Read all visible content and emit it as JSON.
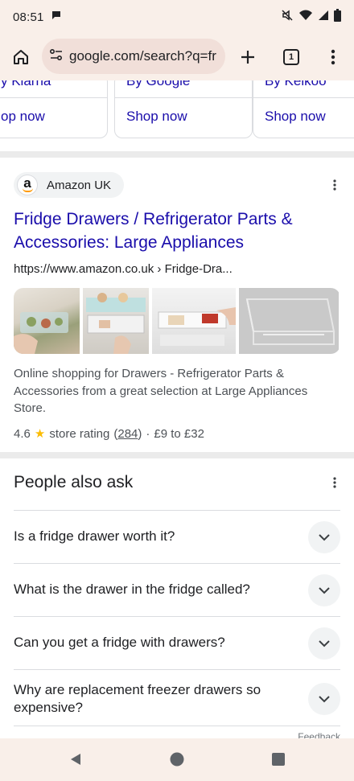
{
  "status": {
    "time": "08:51"
  },
  "browser": {
    "url": "google.com/search?q=fr",
    "tab_count": "1"
  },
  "sellers": [
    {
      "name": "y Klarna",
      "shop": "op now"
    },
    {
      "name": "By Google",
      "shop": "Shop now"
    },
    {
      "name": "By Kelkoo",
      "shop": "Shop now"
    }
  ],
  "result": {
    "source_name": "Amazon UK",
    "logo_letter": "a",
    "title": "Fridge Drawers / Refrigerator Parts & Accessories: Large Appliances",
    "url": "https://www.amazon.co.uk › Fridge-Dra...",
    "snippet": "Online shopping for Drawers - Refrigerator Parts & Accessories from a great selection at Large Appliances Store.",
    "rating_value": "4.6",
    "rating_label": "store rating",
    "review_count": "284",
    "price_range": "£9 to £32"
  },
  "paa": {
    "title": "People also ask",
    "questions": [
      "Is a fridge drawer worth it?",
      "What is the drawer in the fridge called?",
      "Can you get a fridge with drawers?",
      "Why are replacement freezer drawers so expensive?"
    ],
    "feedback": "Feedback"
  },
  "colors": {
    "link": "#1a0dab",
    "chrome_bg": "#f9efe9",
    "omnibox_bg": "#f1dfd9",
    "star": "#fbbc04"
  }
}
